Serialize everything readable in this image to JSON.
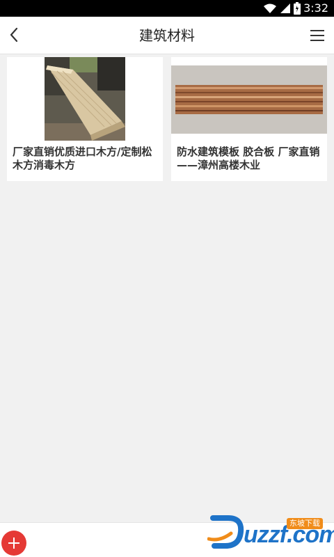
{
  "status_bar": {
    "time": "3:32"
  },
  "app_bar": {
    "title": "建筑材料"
  },
  "products": [
    {
      "caption": "厂家直销优质进口木方/定制松木方消毒木方"
    },
    {
      "caption": "防水建筑模板 胶合板 厂家直销——漳州高楼木业"
    }
  ],
  "watermark": {
    "text": "uzzf.com",
    "badge": "东坡下载"
  },
  "colors": {
    "accent": "#e53935",
    "background": "#f1f1f1",
    "watermark_blue": "#1e73c8"
  },
  "icons": [
    "wifi-icon",
    "signal-icon",
    "battery-icon",
    "back-icon",
    "menu-icon",
    "add-icon"
  ]
}
